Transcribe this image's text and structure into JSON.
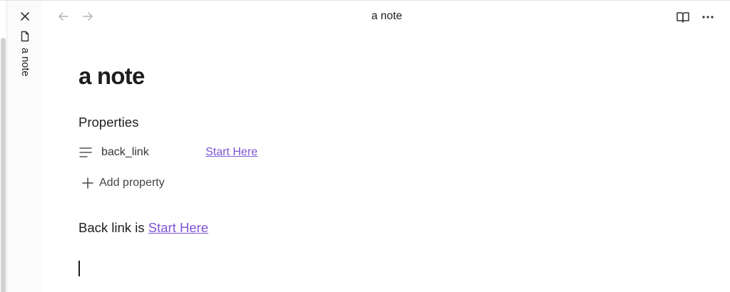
{
  "tab": {
    "close_icon": "close-icon",
    "file_icon": "file-icon",
    "label": "a note"
  },
  "header": {
    "back_icon": "arrow-left-icon",
    "forward_icon": "arrow-right-icon",
    "title": "a note",
    "reading_view_icon": "book-open-icon",
    "more_icon": "more-horizontal-icon"
  },
  "note": {
    "title": "a note",
    "properties_heading": "Properties",
    "properties": [
      {
        "icon": "text-lines-icon",
        "key": "back_link",
        "value": "Start Here"
      }
    ],
    "add_property_label": "Add property",
    "body": {
      "prefix": "Back link is ",
      "link_text": "Start Here"
    }
  },
  "colors": {
    "link": "#7b55d6",
    "text": "#1e1e1e",
    "muted_icon": "#9a9a9a"
  }
}
